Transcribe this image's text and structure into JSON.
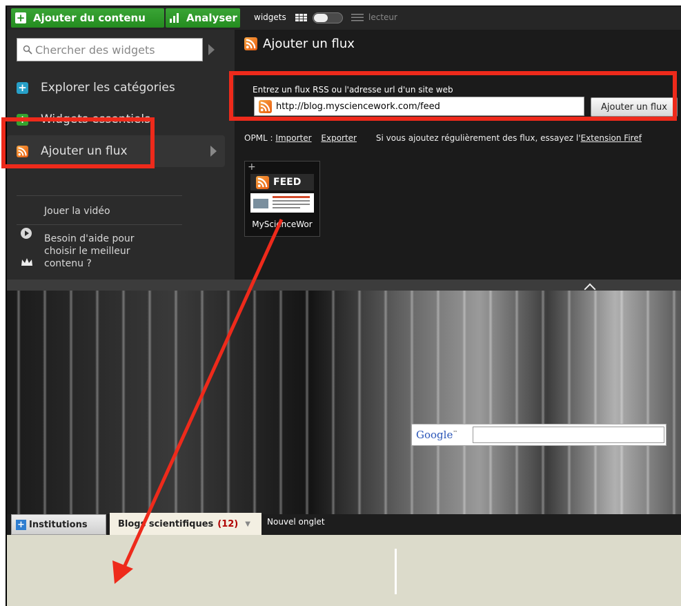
{
  "topbar": {
    "add_content_label": "Ajouter du contenu",
    "analyse_label": "Analyser",
    "widgets_label": "widgets",
    "reader_label": "lecteur"
  },
  "sidebar": {
    "search_placeholder": "Chercher des widgets",
    "items": [
      {
        "label": "Explorer les catégories",
        "icon": "plus-icon"
      },
      {
        "label": "Widgets essentiels",
        "icon": "plus-icon"
      },
      {
        "label": "Ajouter un flux",
        "icon": "rss-icon"
      }
    ],
    "video_label": "Jouer la vidéo",
    "help_lines": [
      "Besoin d'aide pour",
      "choisir le meilleur",
      "contenu ?"
    ]
  },
  "main": {
    "title": "Ajouter un flux",
    "form_label": "Entrez un flux RSS ou l'adresse url d'un site web",
    "url_value": "http://blog.mysciencework.com/feed",
    "add_button": "Ajouter un flux",
    "opml_prefix": "OPML :",
    "import_link": "Importer",
    "export_link": "Exporter",
    "hint_prefix": "Si vous ajoutez régulièrement des flux, essayez l'",
    "hint_link": "Extension Firef"
  },
  "tile": {
    "badge": "FEED",
    "plus": "+",
    "name": "MyScienceWor"
  },
  "google": {
    "logo": "Google",
    "tm": "™"
  },
  "tabs": {
    "institutions": "Institutions",
    "blogs": "Blogs scientifiques",
    "blogs_count": "(12)",
    "new_tab": "Nouvel onglet"
  },
  "colors": {
    "accent_green": "#2e9b2a",
    "highlight_red": "#ee2a1b",
    "rss_orange": "#f08a24",
    "count_red": "#b00000"
  }
}
